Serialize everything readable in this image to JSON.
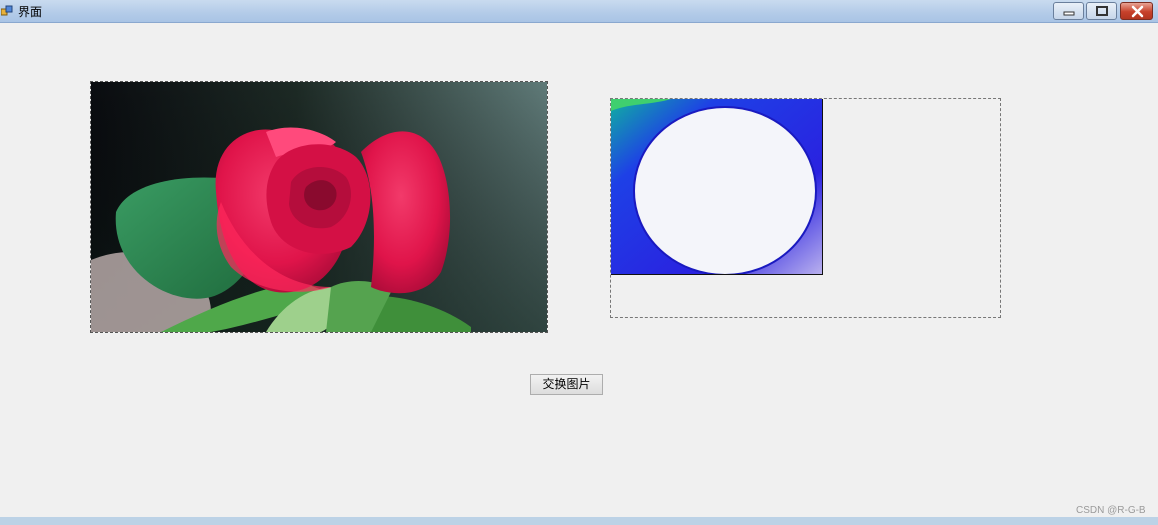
{
  "window": {
    "title": "界面",
    "controls": [
      "minimize",
      "maximize",
      "close"
    ]
  },
  "picture_boxes": [
    {
      "content": "red-rose-photo"
    },
    {
      "content": "blue-white-circle-image"
    }
  ],
  "buttons": {
    "swap_label": "交换图片"
  },
  "watermark": "CSDN @R-G-B",
  "colors": {
    "form_background": "#f0f0f0",
    "titlebar": "#b3cbe8",
    "close_button": "#c7412b",
    "rose": "#e0144a",
    "leaf": "#2f8a4f",
    "circle_image_blue": "#2a22e0"
  }
}
